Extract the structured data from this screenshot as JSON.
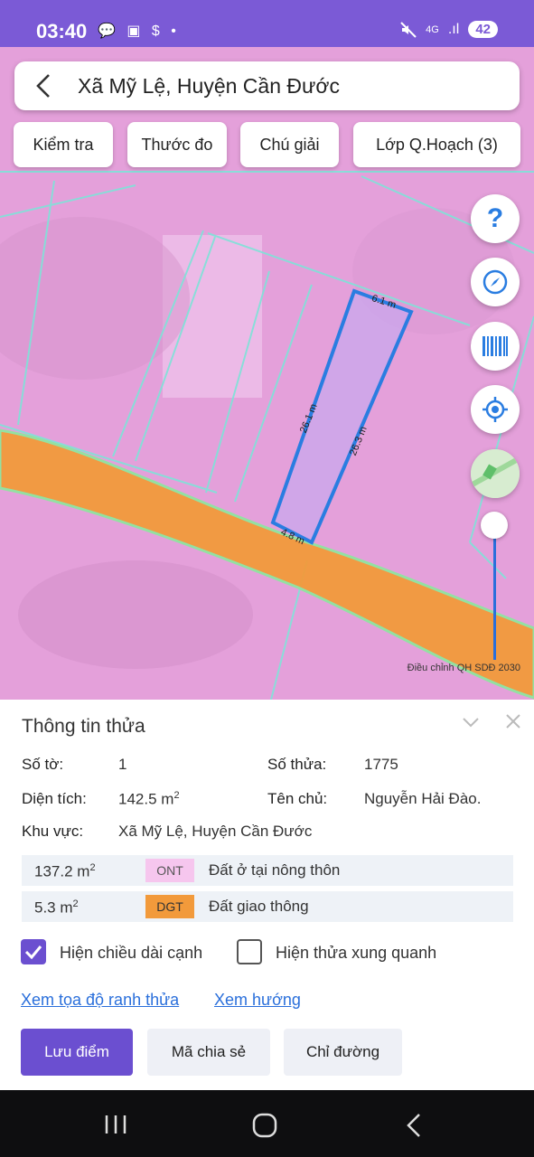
{
  "status_bar": {
    "time": "03:40",
    "left_icons": "💬 ▣ $ •",
    "net": "4G",
    "signal": ".ıl",
    "battery": "42"
  },
  "search": {
    "title": "Xã Mỹ Lệ, Huyện Cần Đước"
  },
  "chips": [
    "Kiểm tra",
    "Thước đo",
    "Chú giải",
    "Lớp Q.Hoạch (3)"
  ],
  "fab_icons": [
    "help-icon",
    "compass-icon",
    "barcode-icon",
    "locate-icon",
    "layer-thumbnail"
  ],
  "map": {
    "parcel_edges": {
      "top": "6.1 m",
      "left": "26.1 m",
      "right": "26.3 m",
      "bottom": "4.8 m"
    },
    "layer_label": "Điều chỉnh QH SDĐ 2030",
    "colors": {
      "land": "#e7a2dd",
      "road": "#f29a3b",
      "parcel": "#2a7de1",
      "boundary": "#7fe3d8"
    }
  },
  "info": {
    "heading": "Thông tin thửa",
    "so_to_label": "Số tờ:",
    "so_to": "1",
    "so_thua_label": "Số thửa:",
    "so_thua": "1775",
    "dien_tich_label": "Diện tích:",
    "dien_tich": "142.5 m",
    "ten_chu_label": "Tên chủ:",
    "ten_chu": "Nguyễn Hải Đào.",
    "khu_vuc_label": "Khu vực:",
    "khu_vuc": "Xã Mỹ Lệ, Huyện Cần Đước",
    "unit_sup": "2",
    "land_uses": [
      {
        "area": "137.2 m",
        "code": "ONT",
        "desc": "Đất ở tại nông thôn",
        "color": "#f6c6ee"
      },
      {
        "area": "5.3 m",
        "code": "DGT",
        "desc": "Đất giao thông",
        "color": "#f29a3b"
      }
    ],
    "cb_edge_length": "Hiện chiều dài cạnh",
    "cb_edge_checked": true,
    "cb_neighbors": "Hiện thửa xung quanh",
    "cb_neighbors_checked": false,
    "link_coords": "Xem tọa độ ranh thửa",
    "link_direction": "Xem hướng",
    "btn_save": "Lưu điểm",
    "btn_share": "Mã chia sẻ",
    "btn_directions": "Chỉ đường"
  }
}
